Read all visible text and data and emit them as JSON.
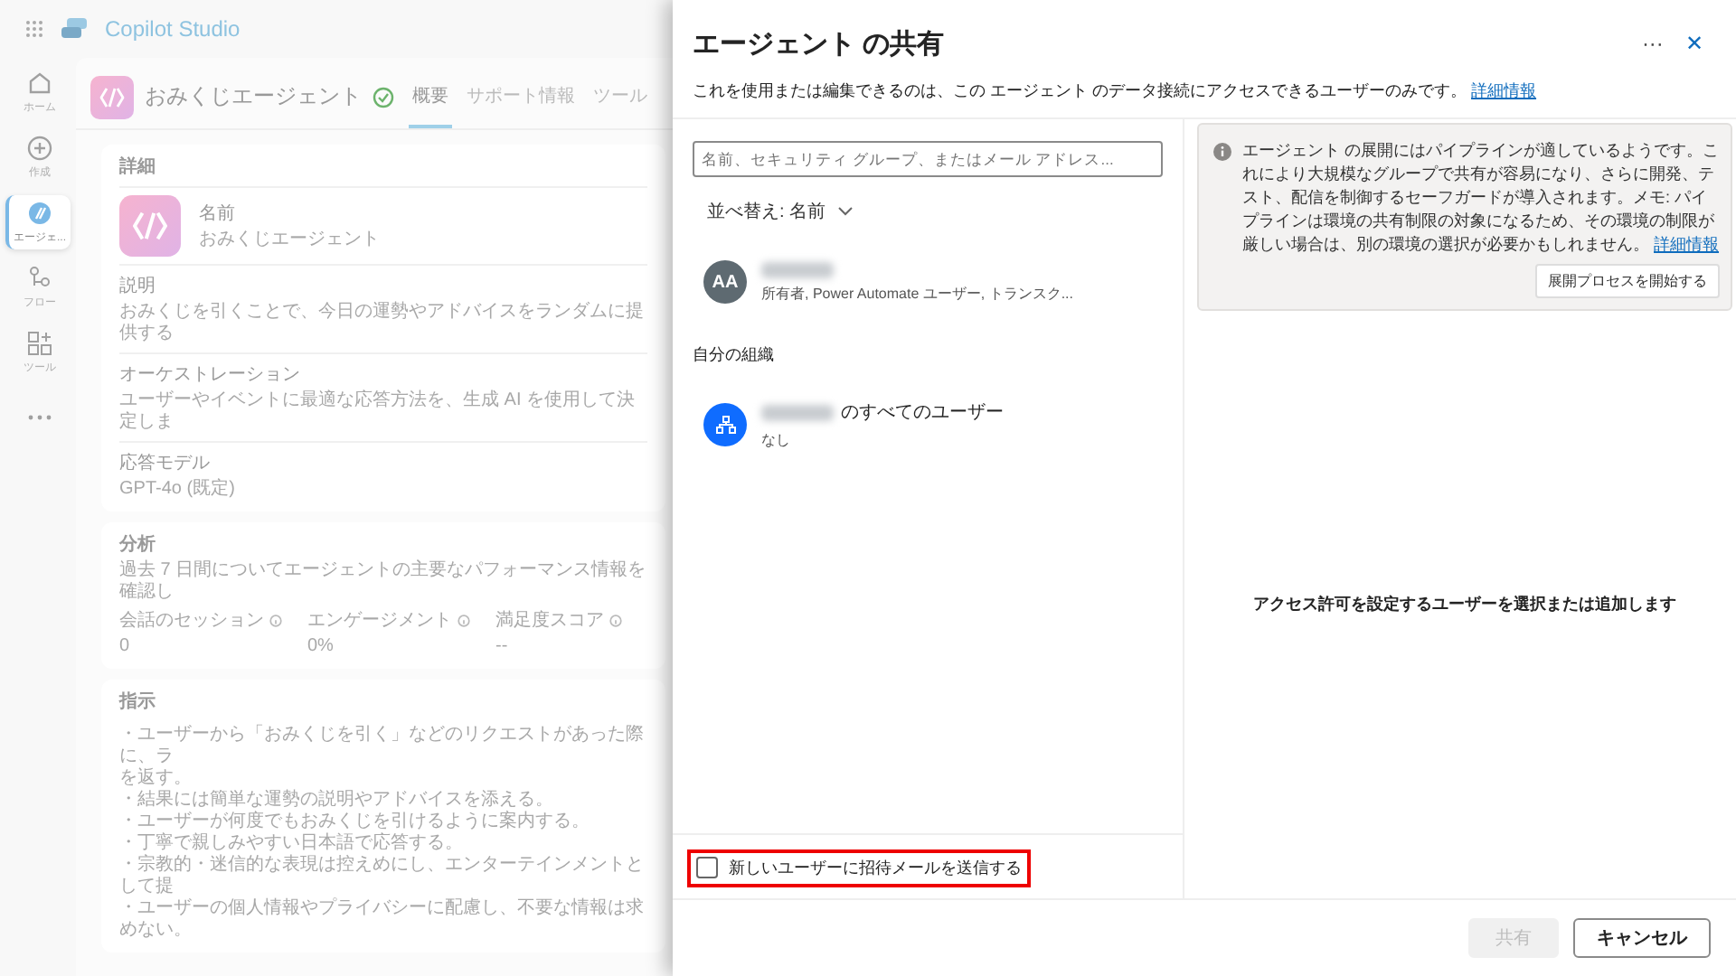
{
  "app": {
    "name": "Copilot Studio"
  },
  "rail": [
    {
      "kind": "home",
      "label": "ホーム",
      "selected": false
    },
    {
      "kind": "create",
      "label": "作成",
      "selected": false
    },
    {
      "kind": "agent",
      "label": "エージェ...",
      "selected": true
    },
    {
      "kind": "flow",
      "label": "フロー",
      "selected": false
    },
    {
      "kind": "tool",
      "label": "ツール",
      "selected": false
    },
    {
      "kind": "more",
      "selected": false
    }
  ],
  "agent": {
    "name": "おみくじエージェント",
    "tabs": [
      {
        "label": "概要",
        "selected": true
      },
      {
        "label": "サポート情報",
        "selected": false
      },
      {
        "label": "ツール",
        "selected": false
      }
    ]
  },
  "details": {
    "title": "詳細",
    "name_label": "名前",
    "name_value": "おみくじエージェント",
    "fields": [
      {
        "label": "説明",
        "value": "おみくじを引くことで、今日の運勢やアドバイスをランダムに提供する"
      },
      {
        "label": "オーケストレーション",
        "value": "ユーザーやイベントに最適な応答方法を、生成 AI を使用して決定しま"
      },
      {
        "label": "応答モデル",
        "value": "GPT-4o (既定)"
      }
    ]
  },
  "analytics": {
    "title": "分析",
    "description": "過去 7 日間についてエージェントの主要なパフォーマンス情報を確認し",
    "metrics": [
      {
        "label": "会話のセッション",
        "value": "0"
      },
      {
        "label": "エンゲージメント",
        "value": "0%"
      },
      {
        "label": "満足度スコア",
        "value": "--"
      }
    ]
  },
  "instructions": {
    "title": "指示",
    "lines": [
      "・ユーザーから「おみくじを引く」などのリクエストがあった際に、ラ",
      "を返す。",
      "・結果には簡単な運勢の説明やアドバイスを添える。",
      "・ユーザーが何度でもおみくじを引けるように案内する。",
      "・丁寧で親しみやすい日本語で応答する。",
      "・宗教的・迷信的な表現は控えめにし、エンターテインメントとして提",
      "・ユーザーの個人情報やプライバシーに配慮し、不要な情報は求めない。"
    ]
  },
  "dialog": {
    "title": "エージェント の共有",
    "more": "···",
    "close": "✕",
    "subtitle": "これを使用または編集できるのは、この エージェント のデータ接続にアクセスできるユーザーのみです。",
    "subtitle_link": "詳細情報",
    "search": {
      "placeholder": "名前、セキュリティ グループ、またはメール アドレス..."
    },
    "sort": "並べ替え: 名前",
    "people": [
      {
        "initials": "AA",
        "role": "所有者, Power Automate ユーザー, トランスク..."
      }
    ],
    "org_heading": "自分の組織",
    "org": {
      "name_suffix": "のすべてのユーザー",
      "role": "なし"
    },
    "notice": {
      "text": "エージェント の展開にはパイプラインが適しているようです。これにより大規模なグループで共有が容易になり、さらに開発、テスト、配信を制御するセーフガードが導入されます。メモ: パイプラインは環境の共有制限の対象になるため、その環境の制限が厳しい場合は、別の環境の選択が必要かもしれません。",
      "link": "詳細情報",
      "button": "展開プロセスを開始する"
    },
    "empty_message": "アクセス許可を設定するユーザーを選択または追加します",
    "invite": {
      "label": "新しいユーザーに招待メールを送信する",
      "checked": false,
      "highlighted": true
    },
    "buttons": [
      {
        "label": "共有",
        "kind": "primary",
        "disabled": true
      },
      {
        "label": "キャンセル",
        "kind": "secondary",
        "disabled": false
      }
    ]
  }
}
